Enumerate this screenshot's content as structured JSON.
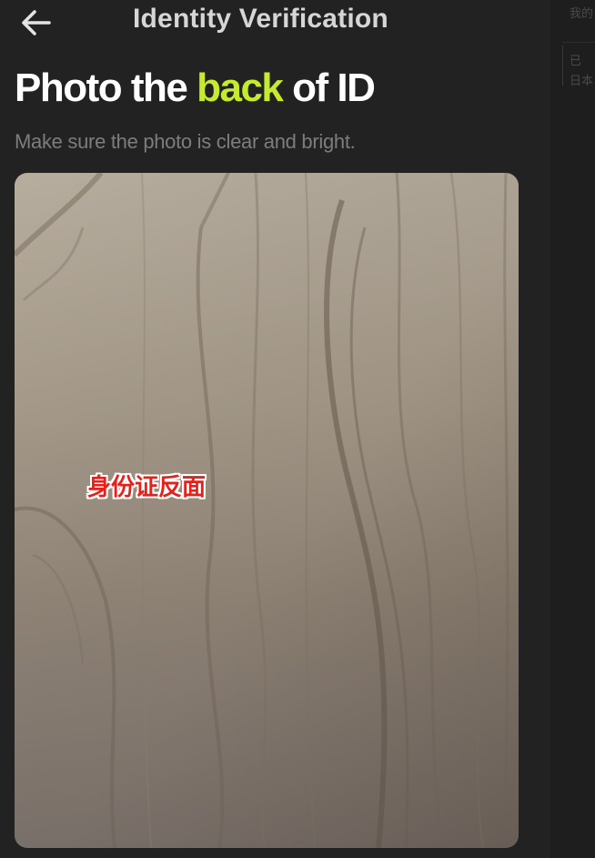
{
  "header": {
    "back_icon": "arrow-left-icon",
    "title": "Identity Verification"
  },
  "heading": {
    "part1": "Photo the ",
    "highlight": "back",
    "part2": " of ID",
    "highlight_color": "#c6ea2d"
  },
  "subtitle": "Make sure the photo is clear and bright.",
  "photo": {
    "label": "身份证反面",
    "label_color": "#e8201a"
  },
  "side_panel": {
    "line1": "我的",
    "line2": "已",
    "line3": "日本"
  }
}
